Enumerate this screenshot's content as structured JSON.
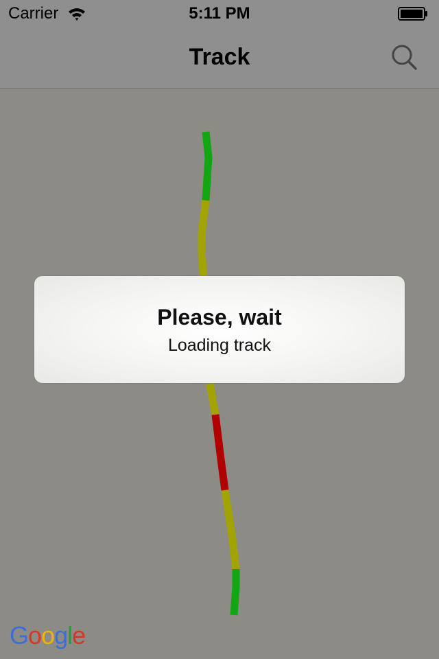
{
  "status_bar": {
    "carrier": "Carrier",
    "time": "5:11 PM",
    "wifi_icon": "wifi-icon",
    "battery_icon": "battery-icon"
  },
  "nav_bar": {
    "title": "Track",
    "search_icon": "search-icon"
  },
  "map": {
    "attribution": "Google",
    "track_colors": {
      "good": "#12a612",
      "medium": "#a3a300",
      "bad": "#b00000"
    }
  },
  "loading": {
    "title": "Please, wait",
    "subtitle": "Loading track"
  },
  "colors": {
    "bar_background": "#8f8f8f",
    "map_background": "#8c8b86",
    "hud_background": "#f4f4f2"
  }
}
